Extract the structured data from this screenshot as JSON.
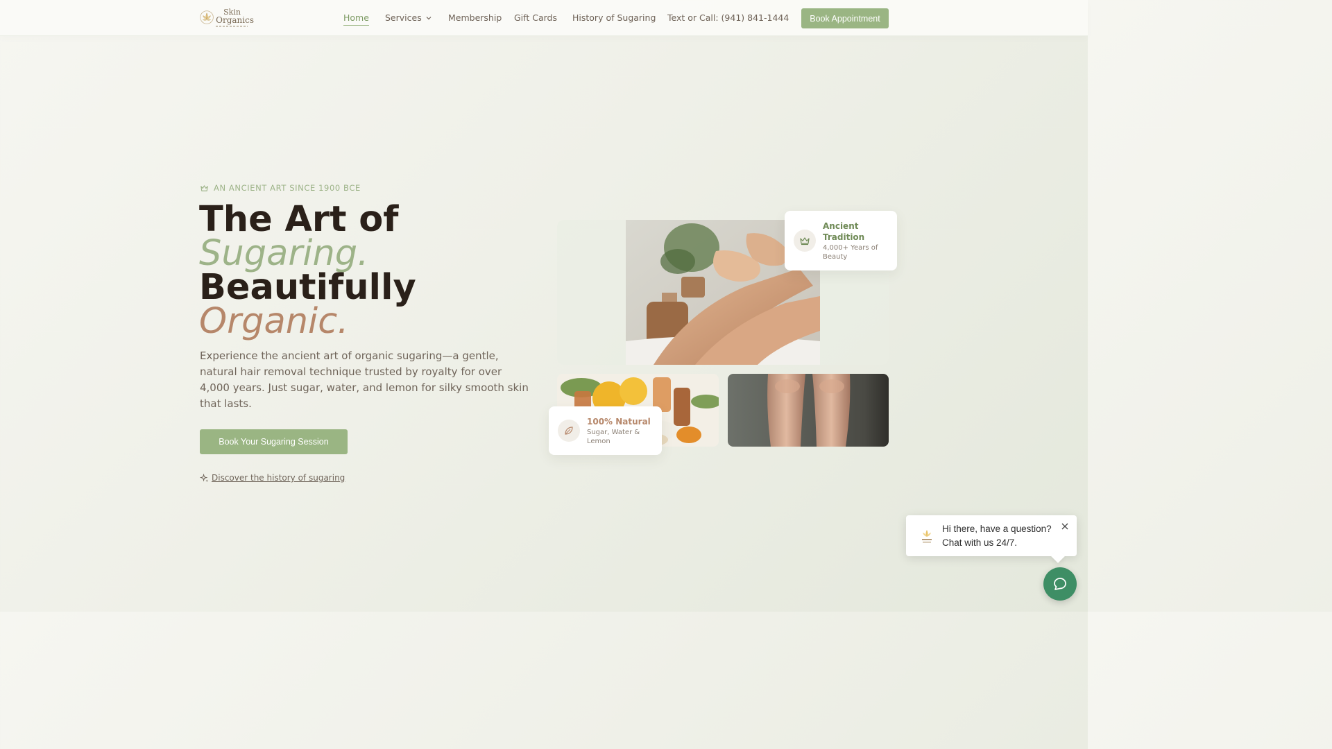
{
  "brand": {
    "name_line1": "Skin",
    "name_line2": "Organics"
  },
  "nav": {
    "home": "Home",
    "services": "Services",
    "membership": "Membership",
    "gift_cards": "Gift Cards",
    "history": "History of Sugaring",
    "phone": "Text or Call: (941) 841-1444",
    "book": "Book Appointment"
  },
  "hero": {
    "eyebrow": "AN ANCIENT ART SINCE 1900 BCE",
    "line1": "The Art of",
    "line2": "Sugaring.",
    "line3": "Beautifully",
    "line4": "Organic.",
    "lede": "Experience the ancient art of organic sugaring—a gentle, natural hair removal technique trusted by royalty for over 4,000 years. Just sugar, water, and lemon for silky smooth skin that lasts.",
    "cta": "Book Your Sugaring Session",
    "history_link": "Discover the history of sugaring"
  },
  "badges": {
    "tradition_title": "Ancient Tradition",
    "tradition_sub": "4,000+ Years of Beauty",
    "natural_title": "100% Natural",
    "natural_sub": "Sugar, Water & Lemon"
  },
  "chat": {
    "line1": "Hi there, have a question?",
    "line2": "Chat with us 24/7."
  },
  "colors": {
    "accent_green": "#9ab583",
    "headline_dark": "#2a2019",
    "headline_brown": "#b6876a",
    "chat_green": "#3e8e65"
  },
  "icons": [
    "crown-icon",
    "sparkle-icon",
    "leaf-icon",
    "chevron-down-icon",
    "close-icon",
    "chat-icon",
    "lotus-logo-icon"
  ]
}
